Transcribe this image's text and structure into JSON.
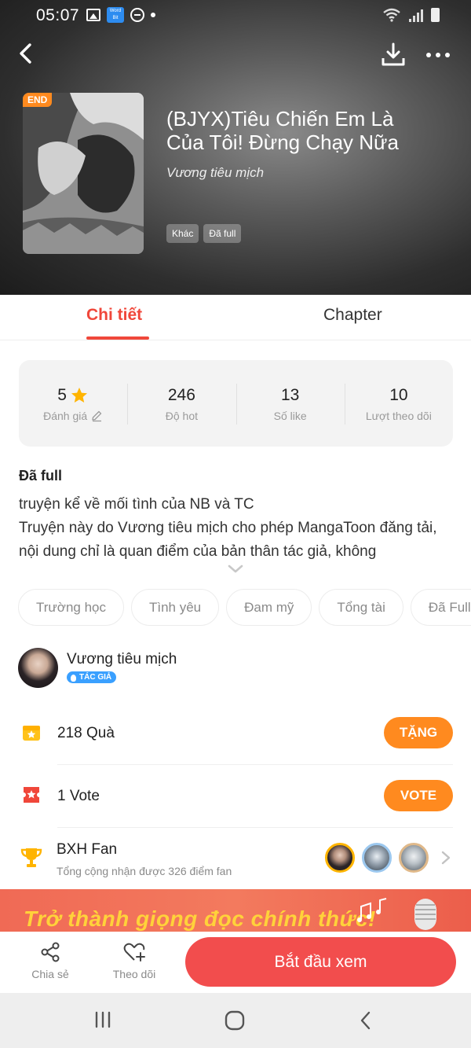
{
  "status_bar": {
    "time": "05:07",
    "app_badge": "Word Bit"
  },
  "header": {
    "back_icon": "chevron-left-icon",
    "download_icon": "download-icon",
    "more_icon": "more-horizontal-icon"
  },
  "book": {
    "badge": "END",
    "title": "(BJYX)Tiêu Chiến Em Là Của Tôi! Đừng Chạy Nữa",
    "author": "Vương tiêu mịch",
    "tags": [
      "Khác",
      "Đã full"
    ]
  },
  "tabs": [
    "Chi tiết",
    "Chapter"
  ],
  "stats": [
    {
      "value": "5",
      "label": "Đánh giá"
    },
    {
      "value": "246",
      "label": "Độ hot"
    },
    {
      "value": "13",
      "label": "Số like"
    },
    {
      "value": "10",
      "label": "Lượt theo dõi"
    }
  ],
  "details": {
    "status": "Đã full",
    "description": "truyện kể về mối tình của NB và TC\nTruyện này do Vương tiêu mịch cho phép MangaToon đăng tải, nội dung chỉ là quan điểm của bản thân tác giả, không"
  },
  "genres": [
    "Trường học",
    "Tình yêu",
    "Đam mỹ",
    "Tổng tài",
    "Đã Full"
  ],
  "author": {
    "name": "Vương tiêu mịch",
    "badge": "TÁC GIẢ"
  },
  "gift": {
    "label": "218 Quà",
    "button": "TẶNG"
  },
  "vote": {
    "label": "1 Vote",
    "button": "VOTE"
  },
  "fan": {
    "title": "BXH Fan",
    "subtitle": "Tổng cộng nhận được 326 điểm fan"
  },
  "banner": {
    "text": "Trở thành giọng đọc chính thức!"
  },
  "bottom": {
    "share": "Chia sẻ",
    "follow": "Theo dõi",
    "start": "Bắt đầu xem"
  },
  "colors": {
    "accent": "#f0473a",
    "orange": "#ff8a1f",
    "start_button": "#f24d4d",
    "banner": "#f06a55"
  }
}
